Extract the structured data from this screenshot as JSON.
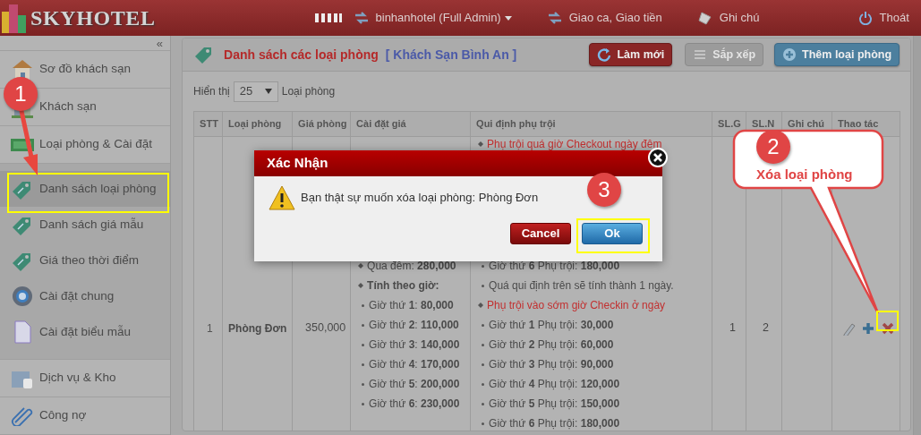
{
  "header": {
    "brand": "SKYHOTEL",
    "user": "binhanhotel (Full Admin)",
    "items": [
      {
        "label": "Giao ca, Giao tiền"
      },
      {
        "label": "Ghi chú"
      },
      {
        "label": "Thoát"
      }
    ]
  },
  "sidebar": {
    "collapse": "«",
    "items": [
      {
        "label": "Sơ đồ khách sạn",
        "selected": false
      },
      {
        "label": "Khách sạn",
        "selected": false
      },
      {
        "label": "Loại phòng & Cài đặt",
        "selected": false,
        "expanded": true,
        "children": [
          {
            "label": "Danh sách loại phòng",
            "selected": true
          },
          {
            "label": "Danh sách giá mẫu",
            "selected": false
          },
          {
            "label": "Giá theo thời điểm",
            "selected": false
          },
          {
            "label": "Cài đặt chung",
            "selected": false
          },
          {
            "label": "Cài đặt biểu mẫu",
            "selected": false
          }
        ]
      },
      {
        "label": "Dịch vụ & Kho",
        "selected": false
      },
      {
        "label": "Công nợ",
        "selected": false
      }
    ]
  },
  "panel": {
    "title": "Danh sách các loại phòng",
    "hotel": "[ Khách Sạn Bình An ]",
    "buttons": [
      {
        "label": "Làm mới",
        "kind": "refresh",
        "disabled": false
      },
      {
        "label": "Sắp xếp",
        "kind": "sort",
        "disabled": true
      },
      {
        "label": "Thêm loại phòng",
        "kind": "add",
        "disabled": false
      }
    ],
    "page_size": {
      "label": "Hiển thị",
      "value": "25",
      "suffix": "Loại phòng"
    }
  },
  "table": {
    "columns": [
      "STT",
      "Loại phòng",
      "Giá phòng",
      "Cài đặt giá",
      "Qui định phụ trội",
      "SL.G",
      "SL.N",
      "Ghi chú",
      "Thao tác"
    ],
    "rows": [
      {
        "stt": "1",
        "name": "Phòng Đơn",
        "price": "350,000",
        "price_settings": [
          {
            "kind": "head",
            "text": "Qua đêm: **280,000**"
          },
          {
            "kind": "group",
            "text": "Tính theo giờ:"
          },
          {
            "kind": "item",
            "text": "Giờ thứ **1**: **80,000**"
          },
          {
            "kind": "item",
            "text": "Giờ thứ **2**: **110,000**"
          },
          {
            "kind": "item",
            "text": "Giờ thứ **3**: **140,000**"
          },
          {
            "kind": "item",
            "text": "Giờ thứ **4**: **170,000**"
          },
          {
            "kind": "item",
            "text": "Giờ thứ **5**: **200,000**"
          },
          {
            "kind": "item",
            "text": "Giờ thứ **6**: **230,000**"
          }
        ],
        "surcharges": [
          {
            "kind": "alert",
            "text": "Phụ trội quá giờ Checkout ngày đêm"
          },
          {
            "kind": "item",
            "text": "Giờ thứ **6** Phụ trội: **180,000**"
          },
          {
            "kind": "item",
            "text": "Quá qui định trên sẽ tính thành 1 ngày."
          },
          {
            "kind": "alert",
            "text": "Phụ trội vào sớm giờ Checkin ở ngày"
          },
          {
            "kind": "item",
            "text": "Giờ thứ **1** Phụ trội: **30,000**"
          },
          {
            "kind": "item",
            "text": "Giờ thứ **2** Phụ trội: **60,000**"
          },
          {
            "kind": "item",
            "text": "Giờ thứ **3** Phụ trội: **90,000**"
          },
          {
            "kind": "item",
            "text": "Giờ thứ **4** Phụ trội: **120,000**"
          },
          {
            "kind": "item",
            "text": "Giờ thứ **5** Phụ trội: **150,000**"
          },
          {
            "kind": "item",
            "text": "Giờ thứ **6** Phụ trội: **180,000**"
          }
        ],
        "sl_g": "1",
        "sl_n": "2"
      }
    ]
  },
  "dialog": {
    "title": "Xác Nhận",
    "message": "Bạn thật sự muốn xóa loại phòng: Phòng Đơn",
    "buttons": [
      {
        "label": "Cancel",
        "kind": "cancel"
      },
      {
        "label": "Ok",
        "kind": "ok"
      }
    ]
  },
  "annotations": [
    {
      "number": "1"
    },
    {
      "number": "2",
      "caption": "Xóa loại phòng"
    },
    {
      "number": "3"
    }
  ]
}
